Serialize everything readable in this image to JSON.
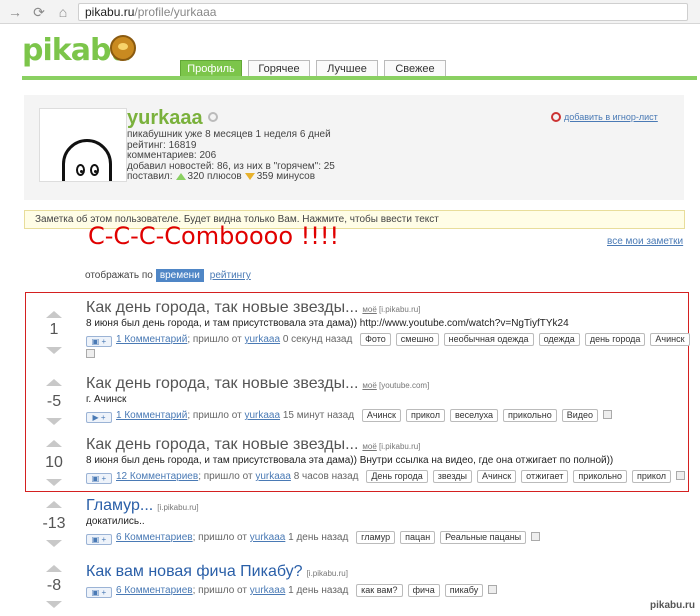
{
  "browser": {
    "back": "→",
    "reload": "⟳",
    "home": "⌂",
    "url_host": "pikabu.ru",
    "url_path": "/profile/yurkaaa"
  },
  "header": {
    "logo": "pikabu",
    "tabs": [
      {
        "label": "Профиль",
        "active": true
      },
      {
        "label": "Горячее",
        "active": false
      },
      {
        "label": "Лучшее",
        "active": false
      },
      {
        "label": "Свежее",
        "active": false
      }
    ]
  },
  "profile": {
    "username": "yurkaaa",
    "line1": "пикабушник уже 8 месяцев 1 неделя 6 дней",
    "line2": "рейтинг: 16819",
    "line3": "комментариев: 206",
    "line4": "добавил новостей: 86, из них в \"горячем\": 25",
    "line5_prefix": "поставил:",
    "plus": "320 плюсов",
    "minus": "359 минусов",
    "ignore": "добавить в игнор-лист"
  },
  "note": {
    "text": "Заметка об этом пользователе. Будет видна только Вам. Нажмите, чтобы ввести текст",
    "all_notes": "все мои заметки"
  },
  "combo": "C-C-C-Combooоо !!!!",
  "sort": {
    "label": "отображать по",
    "active": "времени",
    "other": "рейтингу"
  },
  "posts": [
    {
      "title": "Как день города, так новые звезды...",
      "mine": "моё",
      "source": "[i.pikabu.ru]",
      "rating": "1",
      "desc": "8 июня был день города, и там присутствовала эта дама)) http://www.youtube.com/watch?v=NgTiyfTYk24",
      "comments": "1 Комментарий",
      "from": "; пришло от",
      "author": "yurkaaa",
      "time": "0 секунд назад",
      "tags": [
        "Фото",
        "смешно",
        "необычная одежда",
        "одежда",
        "день города",
        "Ачинск"
      ]
    },
    {
      "title": "Как день города, так новые звезды...",
      "mine": "моё",
      "source": "[youtube.com]",
      "rating": "-5",
      "desc": "г. Ачинск",
      "comments": "1 Комментарий",
      "from": "; пришло от",
      "author": "yurkaaa",
      "time": "15 минут назад",
      "tags": [
        "Ачинск",
        "прикол",
        "веселуха",
        "прикольно",
        "Видео"
      ]
    },
    {
      "title": "Как день города, так новые звезды...",
      "mine": "моё",
      "source": "[i.pikabu.ru]",
      "rating": "10",
      "desc": "8 июня был день города, и там присутствовала эта дама)) Внутри ссылка на видео, где она отжигает по полной))",
      "comments": "12 Комментариев",
      "from": "; пришло от",
      "author": "yurkaaa",
      "time": "8 часов назад",
      "tags": [
        "День города",
        "звезды",
        "Ачинск",
        "отжигает",
        "прикольно",
        "прикол"
      ]
    },
    {
      "title": "Гламур...",
      "mine": "",
      "source": "[i.pikabu.ru]",
      "rating": "-13",
      "desc": "докатились..",
      "comments": "6 Комментариев",
      "from": "; пришло от",
      "author": "yurkaaa",
      "time": "1 день назад",
      "tags": [
        "гламур",
        "пацан",
        "Реальные пацаны"
      ]
    },
    {
      "title": "Как вам новая фича Пикабу?",
      "mine": "",
      "source": "[i.pikabu.ru]",
      "rating": "-8",
      "desc": "",
      "comments": "6 Комментариев",
      "from": "; пришло от",
      "author": "yurkaaa",
      "time": "1 день назад",
      "tags": [
        "как вам?",
        "фича",
        "пикабу"
      ]
    }
  ],
  "watermark": "pikabu.ru",
  "colors": {
    "brand_green": "#7cc54a",
    "link_blue": "#4a7ab5",
    "combo_red": "#e00000",
    "frame_red": "#d42020"
  }
}
